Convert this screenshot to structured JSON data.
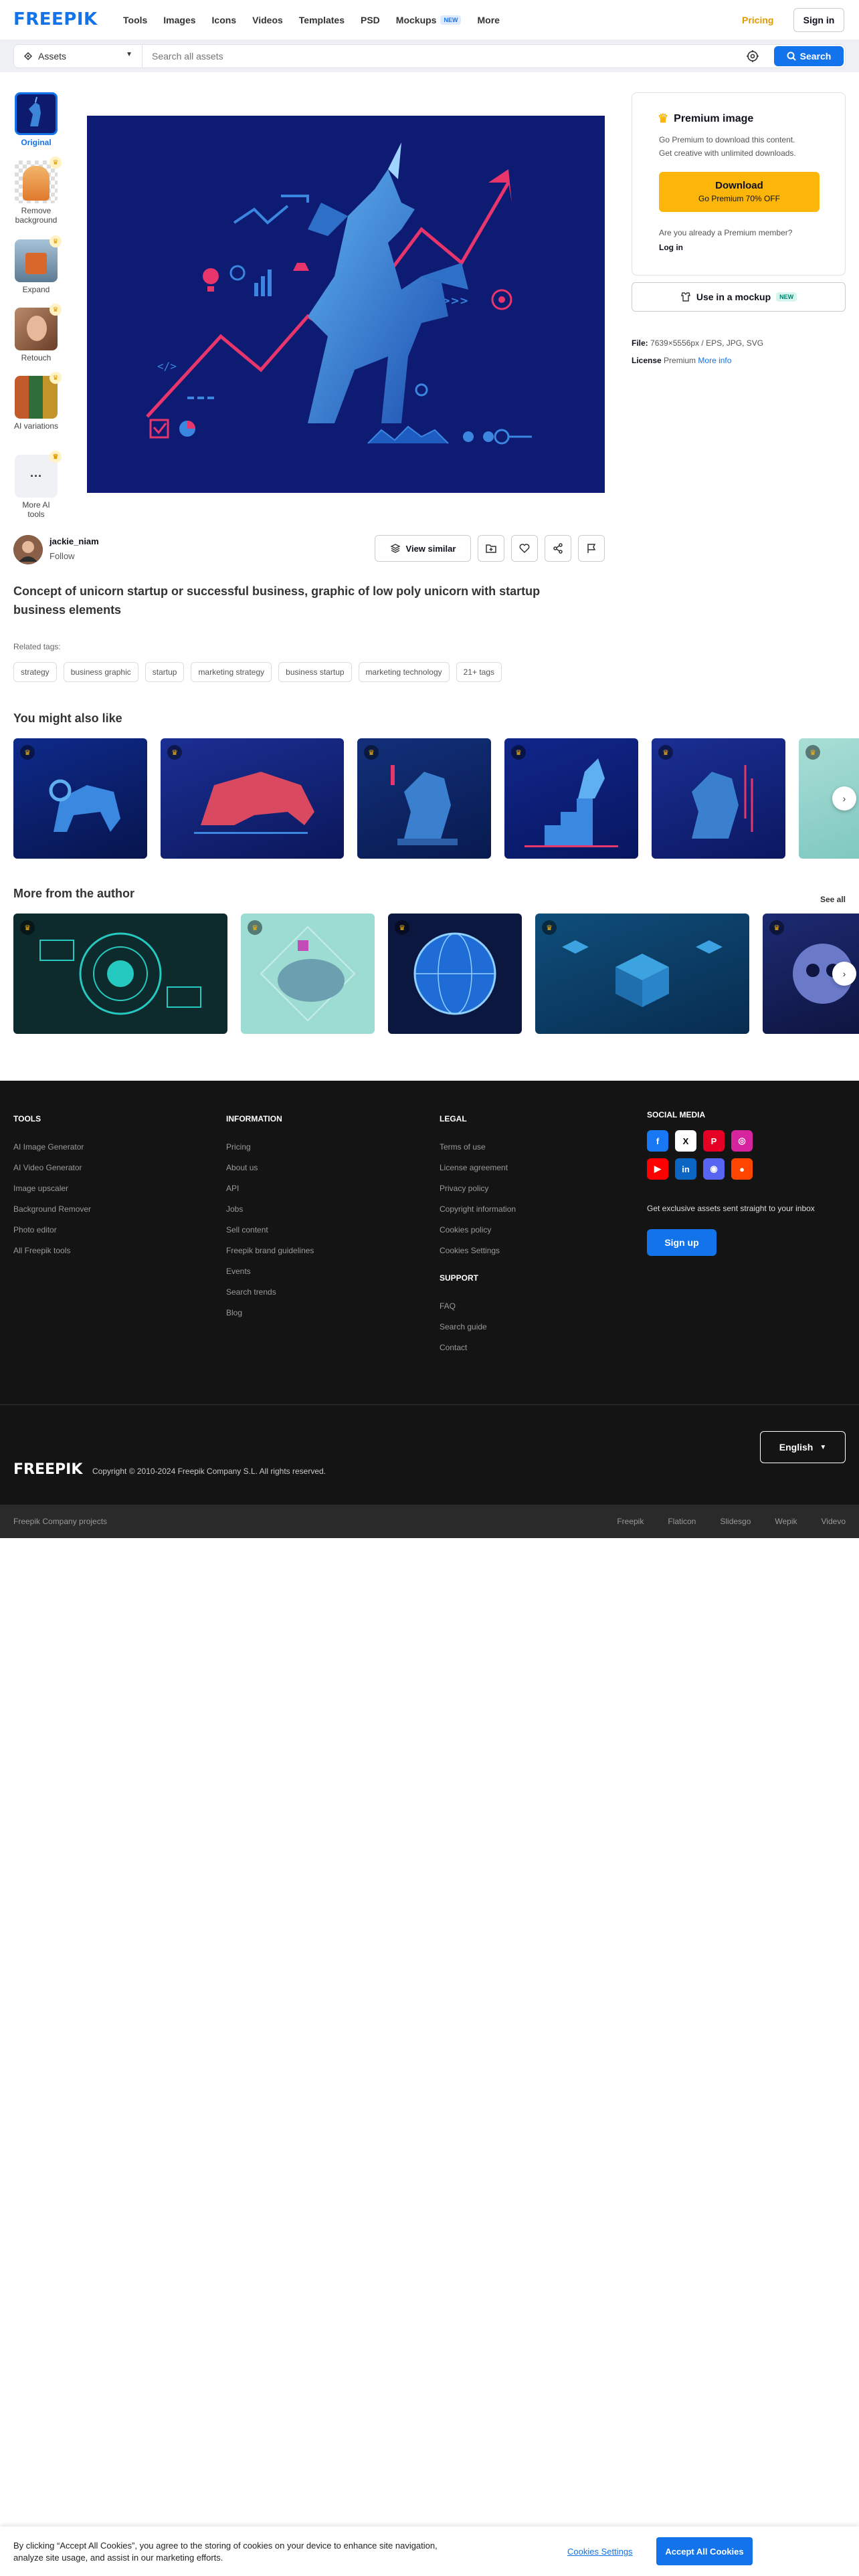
{
  "header": {
    "logo": "FREEPIK",
    "nav": [
      "Tools",
      "Images",
      "Icons",
      "Videos",
      "Templates",
      "PSD",
      "Mockups",
      "More"
    ],
    "mockups_badge": "NEW",
    "pricing": "Pricing",
    "signin": "Sign in"
  },
  "search": {
    "category": "Assets",
    "placeholder": "Search all assets",
    "button": "Search"
  },
  "tools": [
    {
      "label": "Original"
    },
    {
      "label": "Remove background"
    },
    {
      "label": "Expand"
    },
    {
      "label": "Retouch"
    },
    {
      "label": "AI variations"
    },
    {
      "label": "More AI tools"
    }
  ],
  "premium": {
    "title": "Premium image",
    "desc1": "Go Premium to download this content.",
    "desc2": "Get creative with unlimited downloads.",
    "download": "Download",
    "offer": "Go Premium 70% OFF",
    "question": "Are you already a Premium member?",
    "login": "Log in"
  },
  "mockup": {
    "label": "Use in a mockup",
    "badge": "NEW"
  },
  "file": {
    "file_label": "File:",
    "file_value": "7639×5556px / EPS, JPG, SVG",
    "license_label": "License",
    "license_value": "Premium",
    "more_info": "More info"
  },
  "author": {
    "name": "jackie_niam",
    "follow": "Follow"
  },
  "actions": {
    "view_similar": "View similar"
  },
  "title": "Concept of unicorn startup or successful business, graphic of low poly unicorn with startup business elements",
  "related": {
    "label": "Related tags:",
    "tags": [
      "strategy",
      "business graphic",
      "startup",
      "marketing strategy",
      "business startup",
      "marketing technology",
      "21+ tags"
    ]
  },
  "sections": {
    "also_like": "You might also like",
    "more_author": "More from the author",
    "see_all": "See all"
  },
  "footer": {
    "tools": {
      "title": "TOOLS",
      "items": [
        "AI Image Generator",
        "AI Video Generator",
        "Image upscaler",
        "Background Remover",
        "Photo editor",
        "All Freepik tools"
      ]
    },
    "information": {
      "title": "INFORMATION",
      "items": [
        "Pricing",
        "About us",
        "API",
        "Jobs",
        "Sell content",
        "Freepik brand guidelines",
        "Events",
        "Search trends",
        "Blog"
      ]
    },
    "legal": {
      "title": "LEGAL",
      "items": [
        "Terms of use",
        "License agreement",
        "Privacy policy",
        "Copyright information",
        "Cookies policy",
        "Cookies Settings"
      ]
    },
    "support": {
      "title": "SUPPORT",
      "items": [
        "FAQ",
        "Search guide",
        "Contact"
      ]
    },
    "social": {
      "title": "SOCIAL MEDIA"
    },
    "subscribe": "Get exclusive assets sent straight to your inbox",
    "signup": "Sign up",
    "logo": "FREEPIK",
    "copyright": "Copyright © 2010-2024 Freepik Company S.L. All rights reserved.",
    "language": "English",
    "company": "Freepik Company projects",
    "projects": [
      "Freepik",
      "Flaticon",
      "Slidesgo",
      "Wepik",
      "Videvo"
    ]
  },
  "cookie": {
    "text": "By clicking “Accept All Cookies”, you agree to the storing of cookies on your device to enhance site navigation, analyze site usage, and assist in our marketing efforts.",
    "settings": "Cookies Settings",
    "accept": "Accept All Cookies"
  },
  "colors": {
    "brand": "#1273eb",
    "premium": "#fcb60a",
    "footer_bg": "#141414"
  }
}
